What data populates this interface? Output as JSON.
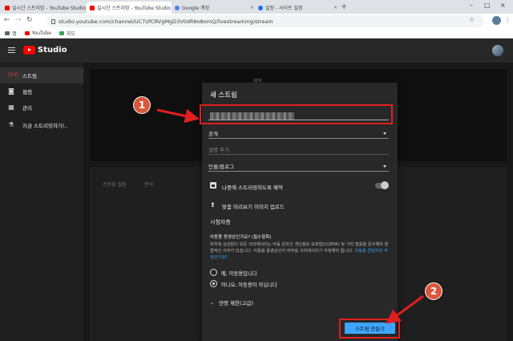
{
  "browser": {
    "tabs": [
      {
        "title": "실시간 스트리밍 - YouTube Studio",
        "favicon_color": "#ff0000",
        "active": false
      },
      {
        "title": "실시간 스트리밍 - YouTube Studio",
        "favicon_color": "#ff0000",
        "active": true
      },
      {
        "title": "Google 계정",
        "favicon_color": "#4285f4",
        "active": false
      },
      {
        "title": "설정 - 사이트 설정",
        "favicon_color": "#1a73e8",
        "active": false
      }
    ],
    "tab_close": "×",
    "new_tab": "+",
    "window_controls": [
      "–",
      "□",
      "×"
    ],
    "url": "studio.youtube.com/channel/UC7UfCRVgMgD3V0dR8o8omQ/livestreaming/stream",
    "bookmarks": [
      {
        "label": "앱",
        "favicon_color": "#5f6368"
      },
      {
        "label": "YouTube",
        "favicon_color": "#ff0000"
      },
      {
        "label": "지도",
        "favicon_color": "#34a853"
      }
    ]
  },
  "studio": {
    "logo_text": "Studio",
    "sidebar": [
      {
        "label": "스트림",
        "icon": "broadcast-icon",
        "glyph": "((•))",
        "active": true
      },
      {
        "label": "웹캠",
        "icon": "camera-icon",
        "glyph": "◙",
        "active": false
      },
      {
        "label": "관리",
        "icon": "calendar-icon",
        "glyph": "▦",
        "active": false
      },
      {
        "label": "지금 스트리밍하기(..",
        "icon": "flask-icon",
        "glyph": "⚗",
        "active": false
      }
    ],
    "background_tabs": [
      "스트림 설정",
      "분석"
    ],
    "background_label": "제목"
  },
  "modal": {
    "title": "새 스트림",
    "visibility_value": "공개",
    "description_placeholder": "설명 추가",
    "category_value": "인물/블로그",
    "schedule_label": "나중에 스트리밍하도록 예약",
    "thumbnail_label": "맞춤 미리보기 이미지 업로드",
    "audience_title": "시청자층",
    "audience_subtitle": "아동용 동영상인가요? (필수항목)",
    "audience_body": "위치에 상관없이 모든 크리에이터는 아동 온라인 개인정보 보호법(COPPA) 및 기타 법률을 준수해야 할 법적인 의무가 있습니다. 아동용 동영상인지 여부를 크리에이터가 지정해야 합니다.",
    "audience_link": "아동용 콘텐츠란 무엇인가요?",
    "radio_yes": "예, 아동용입니다",
    "radio_no": "아니요, 아동용이 아닙니다",
    "age_restriction": "연령 제한(고급)",
    "create_button": "스트림 만들기"
  },
  "annotations": {
    "badge_1": "1",
    "badge_2": "2",
    "highlight_color": "#e01f1f",
    "badge_color": "#d9573a"
  }
}
